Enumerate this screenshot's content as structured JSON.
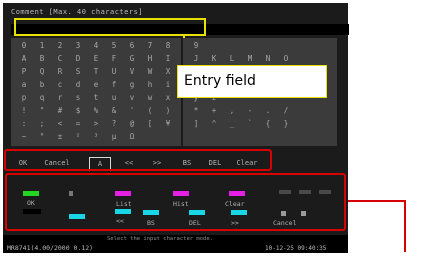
{
  "window": {
    "title": "Comment [Max. 40 characters]"
  },
  "callout": {
    "label": "Entry field"
  },
  "char_grid": [
    [
      "0",
      "1",
      "2",
      "3",
      "4",
      "5",
      "6",
      "7",
      "8",
      "9",
      "",
      "",
      "",
      "",
      ""
    ],
    [
      "A",
      "B",
      "C",
      "D",
      "E",
      "F",
      "G",
      "H",
      "I",
      "J",
      "K",
      "L",
      "M",
      "N",
      "O"
    ],
    [
      "P",
      "Q",
      "R",
      "S",
      "T",
      "U",
      "V",
      "W",
      "X",
      "Y",
      "Z",
      "",
      "",
      "",
      ""
    ],
    [
      "a",
      "b",
      "c",
      "d",
      "e",
      "f",
      "g",
      "h",
      "i",
      "j",
      "k",
      "l",
      "m",
      "n",
      "o"
    ],
    [
      "p",
      "q",
      "r",
      "s",
      "t",
      "u",
      "v",
      "w",
      "x",
      "y",
      "z",
      "",
      "",
      "",
      ""
    ],
    [
      "!",
      "\"",
      "#",
      "$",
      "%",
      "&",
      "'",
      "(",
      ")",
      "*",
      "+",
      ",",
      "-",
      ".",
      "/"
    ],
    [
      ":",
      ";",
      "<",
      "=",
      ">",
      "?",
      "@",
      "[",
      "¥",
      "]",
      "^",
      "_",
      "`",
      "{",
      "}"
    ],
    [
      "~",
      "°",
      "±",
      "²",
      "³",
      "µ",
      "Ω",
      "",
      "",
      "",
      "",
      "",
      "",
      "",
      ""
    ]
  ],
  "key_row": {
    "ok": "OK",
    "cancel": "Cancel",
    "mode": "A",
    "left": "<<",
    "right": ">>",
    "bs": "BS",
    "del": "DEL",
    "clear": "Clear"
  },
  "function_keys": {
    "ok": "OK",
    "list": "List",
    "hist": "Hist",
    "clear": "Clear",
    "left": "<<",
    "bs": "BS",
    "del": "DEL",
    "right": ">>",
    "cancel": "Cancel"
  },
  "status": {
    "message": "Select the input character mode.",
    "firmware": "MR8741(4.00/2000 0.12)",
    "datetime": "10-12-25 09:40:35"
  },
  "colors": {
    "green": "#22d622",
    "cyan": "#19d6e6",
    "magenta": "#e61ee6",
    "yellow": "#e8e000",
    "red": "#d90000"
  }
}
